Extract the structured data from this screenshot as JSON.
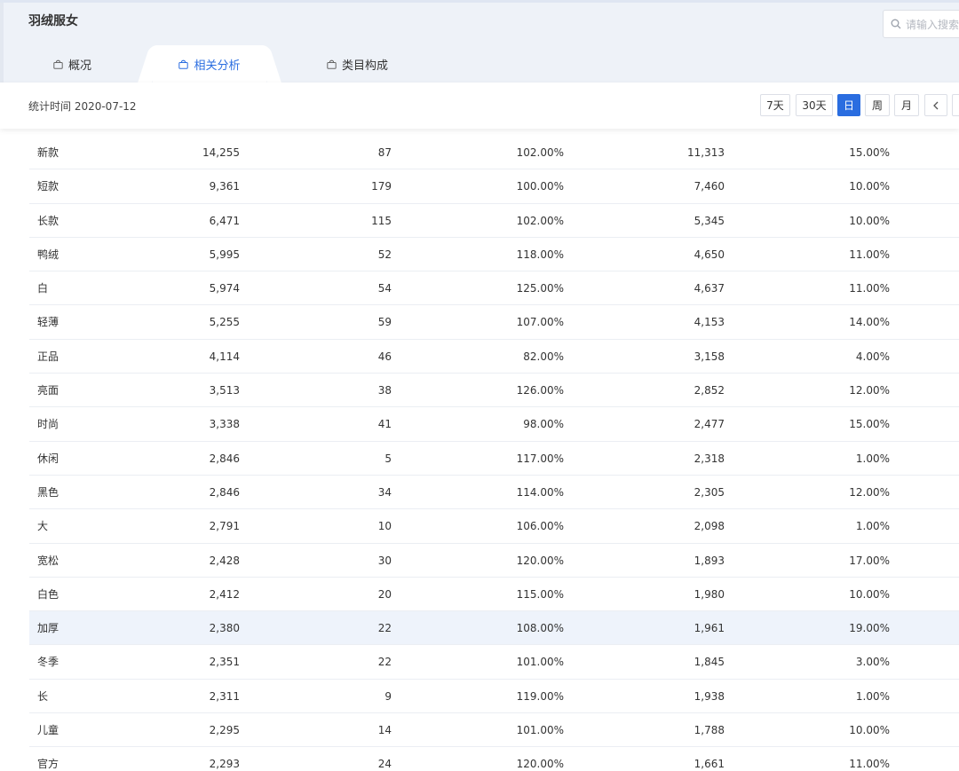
{
  "app": {
    "title": "羽绒服女",
    "search_placeholder": "请输入搜索"
  },
  "tabs": [
    {
      "label": "概况",
      "icon": "bag-icon"
    },
    {
      "label": "相关分析",
      "icon": "bag-icon",
      "active": true
    },
    {
      "label": "类目构成",
      "icon": "bag-icon"
    }
  ],
  "toolbar": {
    "stat_time": "统计时间 2020-07-12",
    "periods": [
      "7天",
      "30天",
      "日",
      "周",
      "月"
    ],
    "active_period": "日",
    "prev_icon": "chevron-left-icon"
  },
  "colors": {
    "accent": "#2a6de0",
    "header_bg": "#eef2f8",
    "row_highlight": "#eef3fb"
  },
  "table": {
    "rows": [
      [
        "新款",
        "14,255",
        "87",
        "102.00%",
        "11,313",
        "15.00%"
      ],
      [
        "短款",
        "9,361",
        "179",
        "100.00%",
        "7,460",
        "10.00%"
      ],
      [
        "长款",
        "6,471",
        "115",
        "102.00%",
        "5,345",
        "10.00%"
      ],
      [
        "鸭绒",
        "5,995",
        "52",
        "118.00%",
        "4,650",
        "11.00%"
      ],
      [
        "白",
        "5,974",
        "54",
        "125.00%",
        "4,637",
        "11.00%"
      ],
      [
        "轻薄",
        "5,255",
        "59",
        "107.00%",
        "4,153",
        "14.00%"
      ],
      [
        "正品",
        "4,114",
        "46",
        "82.00%",
        "3,158",
        "4.00%"
      ],
      [
        "亮面",
        "3,513",
        "38",
        "126.00%",
        "2,852",
        "12.00%"
      ],
      [
        "时尚",
        "3,338",
        "41",
        "98.00%",
        "2,477",
        "15.00%"
      ],
      [
        "休闲",
        "2,846",
        "5",
        "117.00%",
        "2,318",
        "1.00%"
      ],
      [
        "黑色",
        "2,846",
        "34",
        "114.00%",
        "2,305",
        "12.00%"
      ],
      [
        "大",
        "2,791",
        "10",
        "106.00%",
        "2,098",
        "1.00%"
      ],
      [
        "宽松",
        "2,428",
        "30",
        "120.00%",
        "1,893",
        "17.00%"
      ],
      [
        "白色",
        "2,412",
        "20",
        "115.00%",
        "1,980",
        "10.00%"
      ],
      [
        "加厚",
        "2,380",
        "22",
        "108.00%",
        "1,961",
        "19.00%"
      ],
      [
        "冬季",
        "2,351",
        "22",
        "101.00%",
        "1,845",
        "3.00%"
      ],
      [
        "长",
        "2,311",
        "9",
        "119.00%",
        "1,938",
        "1.00%"
      ],
      [
        "儿童",
        "2,295",
        "14",
        "101.00%",
        "1,788",
        "10.00%"
      ],
      [
        "官方",
        "2,293",
        "24",
        "120.00%",
        "1,661",
        "11.00%"
      ]
    ],
    "highlighted_row": "加厚"
  }
}
